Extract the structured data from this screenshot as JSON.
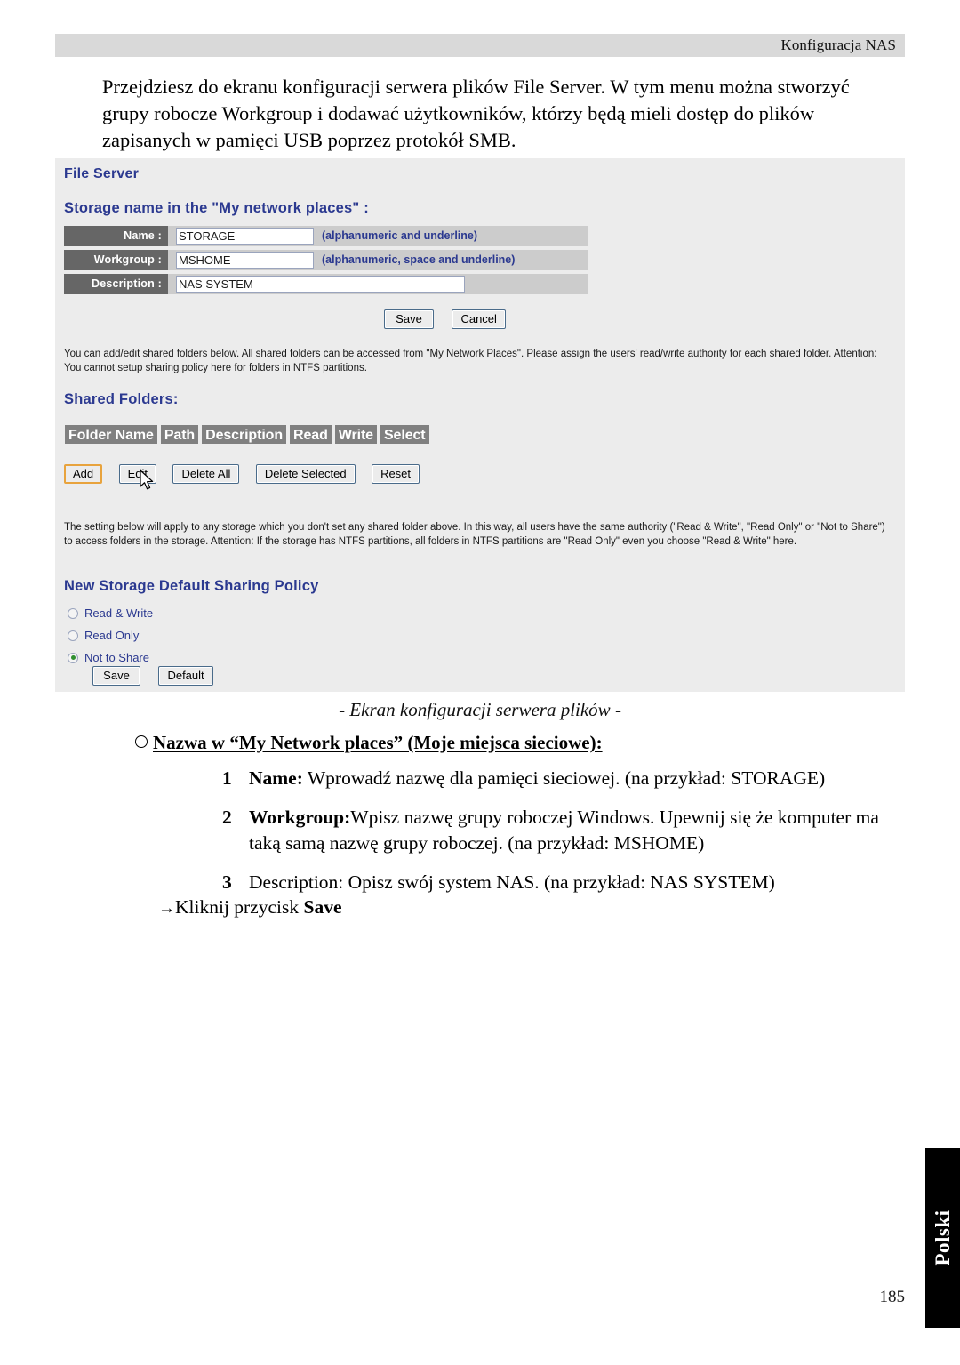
{
  "header": {
    "running_title": "Konfiguracja NAS"
  },
  "intro": {
    "paragraph": "Przejdziesz do ekranu konfiguracji serwera plików File Server. W tym menu można stworzyć grupy robocze Workgroup i dodawać użytkowników, którzy będą mieli dostęp do plików zapisanych w pamięci USB poprzez protokół SMB."
  },
  "panel": {
    "title": "File Server",
    "storage_section_title": "Storage name in the \"My network places\"  :",
    "fields": [
      {
        "label": "Name  :",
        "value": "STORAGE",
        "hint": "(alphanumeric and underline)"
      },
      {
        "label": "Workgroup  :",
        "value": "MSHOME",
        "hint": "(alphanumeric, space and underline)"
      },
      {
        "label": "Description  :",
        "value": "NAS SYSTEM",
        "hint": ""
      }
    ],
    "storage_buttons": {
      "save": "Save",
      "cancel": "Cancel"
    },
    "note_shared_folders": "You can add/edit shared folders below. All shared folders can be accessed from \"My Network Places\". Please assign the users' read/write authority for each shared folder. Attention: You cannot setup sharing policy here for folders in NTFS partitions.",
    "shared_folders_title": "Shared Folders:",
    "table_headers": [
      "Folder Name",
      "Path",
      "Description",
      "Read",
      "Write",
      "Select"
    ],
    "folder_buttons": {
      "add": "Add",
      "edit": "Edit",
      "delete_all": "Delete All",
      "delete_selected": "Delete Selected",
      "reset": "Reset"
    },
    "note_policy": "The setting below will apply to any storage which you don't set any shared folder above. In this way, all users have the same authority (\"Read & Write\", \"Read Only\" or \"Not to Share\") to access folders in the storage. Attention: If the storage has NTFS partitions, all folders in NTFS partitions are \"Read Only\" even you choose \"Read & Write\" here.",
    "policy_title": "New Storage Default Sharing Policy",
    "policy_options": [
      {
        "label": "Read & Write",
        "selected": false
      },
      {
        "label": "Read Only",
        "selected": false
      },
      {
        "label": "Not to Share",
        "selected": true
      }
    ],
    "policy_buttons": {
      "save": "Save",
      "default": "Default"
    },
    "focused_button": "Add",
    "focus_color": "#e8a33d",
    "heading_color": "#2b3990"
  },
  "caption": "- Ekran konfiguracji serwera plików -",
  "bullet_heading": "Nazwa w “My Network places” (Moje miejsca sieciowe):",
  "steps": [
    {
      "number": "1",
      "bold": "Name:",
      "text": " Wprowadź nazwę dla pamięci sieciowej. (na przykład: STORAGE)"
    },
    {
      "number": "2",
      "bold": "Workgroup:",
      "text": "Wpisz nazwę grupy roboczej Windows. Upewnij się że komputer ma taką samą nazwę grupy roboczej. (na przykład: MSHOME)"
    },
    {
      "number": "3",
      "bold": "",
      "text": "Description: Opisz swój system NAS. (na przykład: NAS SYSTEM)"
    }
  ],
  "final_instruction": {
    "arrow": "→",
    "text": "Kliknij przycisk ",
    "bold": "Save"
  },
  "side_tab": {
    "label": "Polski"
  },
  "page_number": "185"
}
